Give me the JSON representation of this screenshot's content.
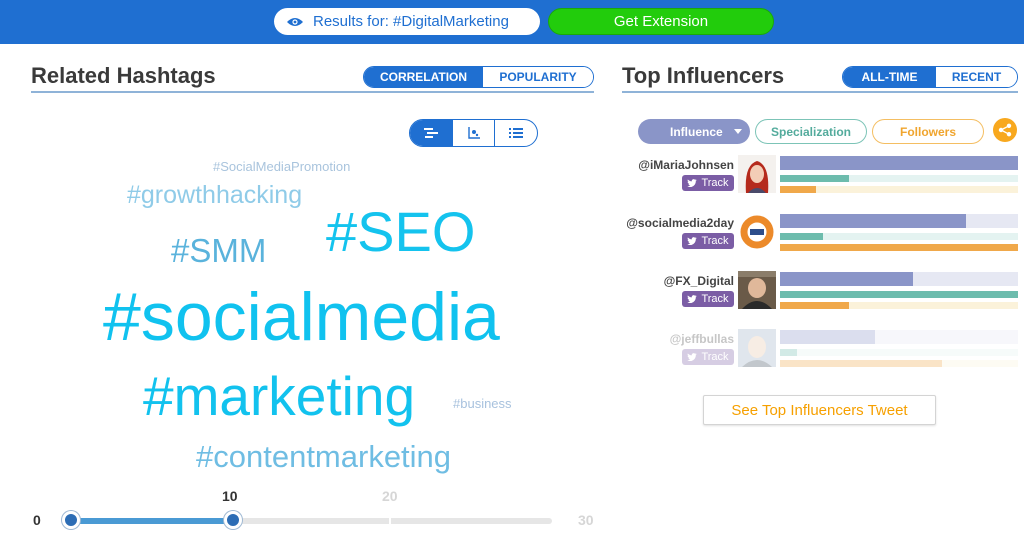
{
  "topbar": {
    "results_label": "Results for: #DigitalMarketing",
    "extension_label": "Get Extension"
  },
  "hashtags": {
    "title": "Related Hashtags",
    "tabs": [
      "CORRELATION",
      "POPULARITY"
    ],
    "active_tab": "CORRELATION",
    "view_icons": [
      "cloud-view-icon",
      "scatter-view-icon",
      "list-view-icon"
    ],
    "words": [
      {
        "text": "#SocialMediaPromotion",
        "color": "#a9c4dd"
      },
      {
        "text": "#growthhacking",
        "color": "#8fcbe8"
      },
      {
        "text": "#SEO",
        "color": "#14c3ee"
      },
      {
        "text": "#SMM",
        "color": "#5ab3dc"
      },
      {
        "text": "#socialmedia",
        "color": "#10c2ef"
      },
      {
        "text": "#marketing",
        "color": "#12c2ee"
      },
      {
        "text": "#business",
        "color": "#a8c2de"
      },
      {
        "text": "#contentmarketing",
        "color": "#6fbde3"
      }
    ],
    "slider": {
      "min_label": "0",
      "max_label": "30",
      "tick_20": "20",
      "value_label": "10",
      "value": 10,
      "range": [
        0,
        30
      ]
    }
  },
  "influencers": {
    "title": "Top Influencers",
    "tabs": [
      "ALL-TIME",
      "RECENT"
    ],
    "active_tab": "ALL-TIME",
    "filters": [
      "Influence",
      "Specialization",
      "Followers"
    ],
    "active_filter": "Influence",
    "track_label": "Track",
    "rows": [
      {
        "handle": "@iMariaJohnsen",
        "influence": 1.0,
        "specialization": 0.29,
        "followers": 0.15
      },
      {
        "handle": "@socialmedia2day",
        "influence": 0.78,
        "specialization": 0.18,
        "followers": 1.0
      },
      {
        "handle": "@FX_Digital",
        "influence": 0.56,
        "specialization": 1.0,
        "followers": 0.29
      },
      {
        "handle": "@jeffbullas",
        "influence": 0.4,
        "specialization": 0.07,
        "followers": 0.68
      }
    ],
    "see_more_label": "See Top Influencers Tweet"
  },
  "colors": {
    "brand_blue": "#1f6fd1",
    "extension_green": "#22cc0c",
    "track_purple": "#7b5da5",
    "influence_bar": "#8a95c8",
    "specialization_bar": "#6dbcad",
    "followers_bar": "#f0a84a",
    "accent_orange": "#f6a000"
  }
}
